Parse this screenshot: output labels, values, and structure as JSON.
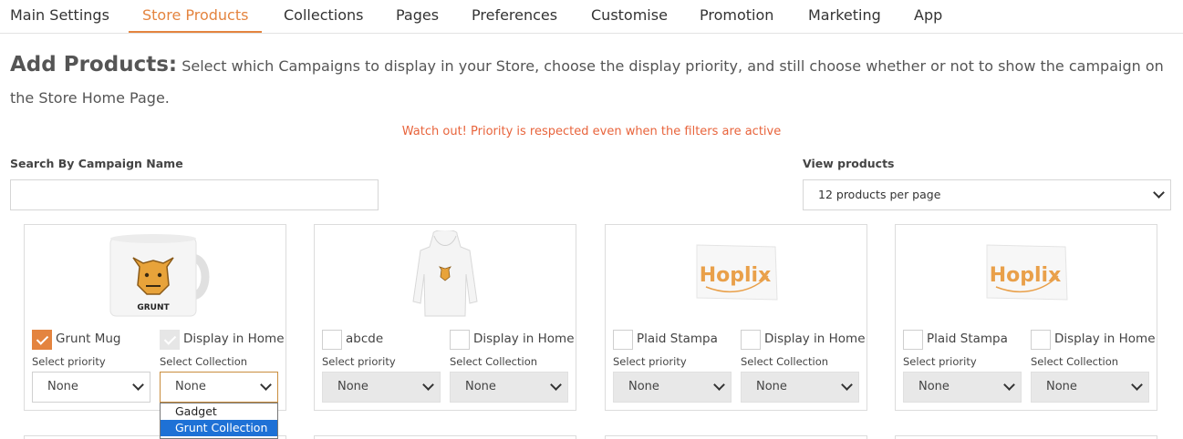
{
  "tabs": [
    {
      "label": "Main Settings"
    },
    {
      "label": "Store Products",
      "active": true
    },
    {
      "label": "Collections"
    },
    {
      "label": "Pages"
    },
    {
      "label": "Preferences"
    },
    {
      "label": "Customise"
    },
    {
      "label": "Promotion"
    },
    {
      "label": "Marketing"
    },
    {
      "label": "App"
    }
  ],
  "heading": {
    "title": "Add Products:",
    "description": "Select which Campaigns to display in your Store, choose the display priority, and still choose whether or not to show the campaign on the Store Home Page."
  },
  "warning": "Watch out! Priority is respected even when the filters are active",
  "search": {
    "label": "Search By Campaign Name",
    "value": "",
    "placeholder": ""
  },
  "view": {
    "label": "View products",
    "selected": "12 products per page"
  },
  "colors": {
    "accent": "#e4843f",
    "warning": "#e8643c",
    "highlight": "#1e71d6"
  },
  "products": [
    {
      "image_icon": "grunt-mug-image",
      "name": "Grunt Mug",
      "selected": true,
      "display_label": "Display in Home",
      "display_in_home": true,
      "priority_label": "Select priority",
      "priority": "None",
      "collection_label": "Select Collection",
      "collection": "None",
      "mug_text": "GRUNT"
    },
    {
      "image_icon": "hoodie-image",
      "name": "abcde",
      "selected": false,
      "display_label": "Display in Home",
      "display_in_home": false,
      "priority_label": "Select priority",
      "priority": "None",
      "collection_label": "Select Collection",
      "collection": "None"
    },
    {
      "image_icon": "hoplix-flag-image",
      "name": "Plaid Stampa",
      "selected": false,
      "display_label": "Display in Home",
      "display_in_home": false,
      "priority_label": "Select priority",
      "priority": "None",
      "collection_label": "Select Collection",
      "collection": "None",
      "flag_text": "Hoplix"
    },
    {
      "image_icon": "hoplix-flag-image",
      "name": "Plaid Stampa",
      "selected": false,
      "display_label": "Display in Home",
      "display_in_home": false,
      "priority_label": "Select priority",
      "priority": "None",
      "collection_label": "Select Collection",
      "collection": "None",
      "flag_text": "Hoplix"
    }
  ],
  "collection_dropdown": {
    "options": [
      "Gadget",
      "Grunt Collection"
    ],
    "highlighted": "Grunt Collection"
  }
}
